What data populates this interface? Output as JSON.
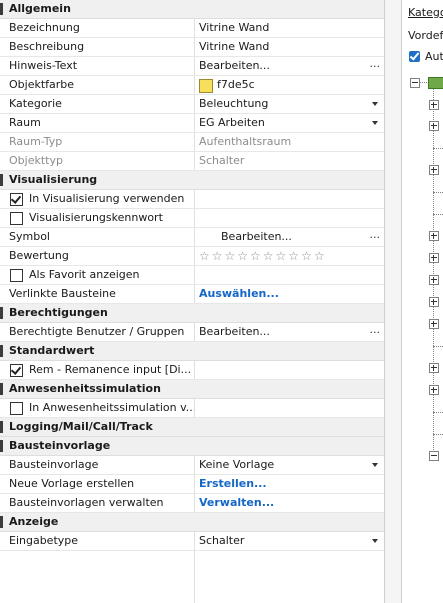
{
  "sections": {
    "allgemein": "Allgemein",
    "visualisierung": "Visualisierung",
    "berechtigungen": "Berechtigungen",
    "standardwert": "Standardwert",
    "anwesenheit": "Anwesenheitssimulation",
    "logging": "Logging/Mail/Call/Track",
    "bausteinvorlage": "Bausteinvorlage",
    "anzeige": "Anzeige"
  },
  "allgemein": {
    "bezeichnung": {
      "label": "Bezeichnung",
      "value": "Vitrine Wand"
    },
    "beschreibung": {
      "label": "Beschreibung",
      "value": "Vitrine Wand"
    },
    "hinweis": {
      "label": "Hinweis-Text",
      "value": "Bearbeiten...",
      "button": "..."
    },
    "objektfarbe": {
      "label": "Objektfarbe",
      "value": "f7de5c",
      "color": "#f7de5c"
    },
    "kategorie": {
      "label": "Kategorie",
      "value": "Beleuchtung"
    },
    "raum": {
      "label": "Raum",
      "value": "EG Arbeiten"
    },
    "raumtyp": {
      "label": "Raum-Typ",
      "value": "Aufenthaltsraum"
    },
    "objekttyp": {
      "label": "Objekttyp",
      "value": "Schalter"
    }
  },
  "visualisierung": {
    "in_vis": {
      "label": "In Visualisierung verwenden",
      "checked": true
    },
    "kennwort": {
      "label": "Visualisierungskennwort",
      "checked": false
    },
    "symbol": {
      "label": "Symbol",
      "value": "Bearbeiten...",
      "button": "..."
    },
    "bewertung": {
      "label": "Bewertung",
      "stars": "☆☆☆☆☆☆☆☆☆☆",
      "rating": 0,
      "max": 10
    },
    "favorit": {
      "label": "Als Favorit anzeigen",
      "checked": false
    },
    "verlinkte": {
      "label": "Verlinkte Bausteine",
      "value": "Auswählen..."
    }
  },
  "berechtigungen": {
    "benutzer": {
      "label": "Berechtigte Benutzer / Gruppen",
      "value": "Bearbeiten...",
      "button": "..."
    }
  },
  "standardwert": {
    "rem": {
      "label": "Rem - Remanence input [Di...",
      "checked": true
    }
  },
  "anwesenheit": {
    "in_sim": {
      "label": "In Anwesenheitssimulation v...",
      "checked": false
    }
  },
  "bausteinvorlage": {
    "vorlage": {
      "label": "Bausteinvorlage",
      "value": "Keine Vorlage"
    },
    "neu": {
      "label": "Neue Vorlage erstellen",
      "value": "Erstellen..."
    },
    "verwalten": {
      "label": "Bausteinvorlagen verwalten",
      "value": "Verwalten..."
    }
  },
  "anzeige": {
    "eingabetyp": {
      "label": "Eingabetype",
      "value": "Schalter"
    }
  },
  "right_panel": {
    "kategorie_label": "Kategor",
    "vordefiniert_label": "Vordefi",
    "auto_label": "Aut"
  }
}
